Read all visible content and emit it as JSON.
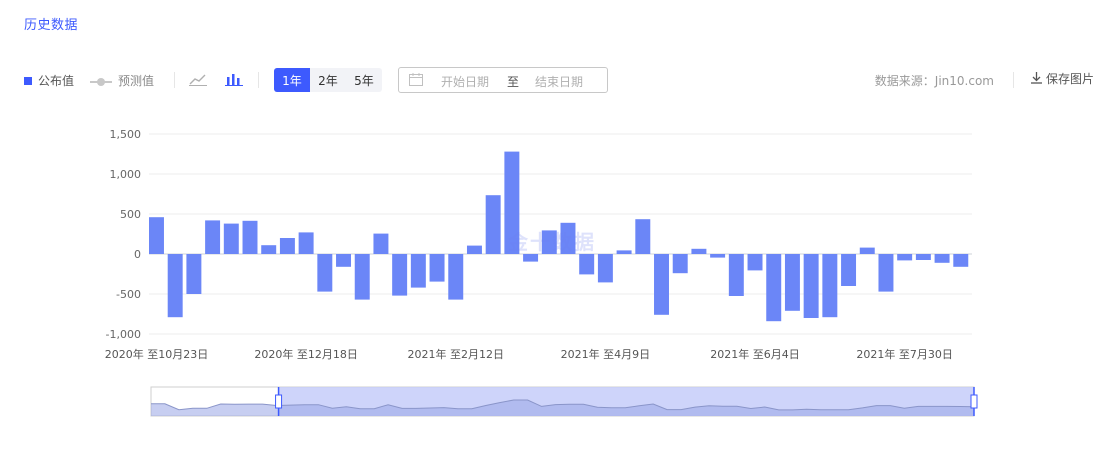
{
  "page": {
    "title": "历史数据"
  },
  "toolbar": {
    "legend_published": "公布值",
    "legend_forecast": "预测值",
    "icons": {
      "line": "line-chart-icon",
      "bar": "bar-chart-icon",
      "calendar": "calendar-icon",
      "download": "download-icon"
    },
    "ranges": [
      "1年",
      "2年",
      "5年"
    ],
    "active_range": "1年",
    "start_placeholder": "开始日期",
    "to_label": "至",
    "end_placeholder": "结束日期",
    "source": "数据来源：Jin10.com",
    "save_label": "保存图片"
  },
  "watermark": "金十数据",
  "colors": {
    "accent": "#3d5afe",
    "bar": "#6b86f7",
    "navigator_fill": "#c5ccf9",
    "navigator_area": "#99a6e6"
  },
  "chart_data": {
    "type": "bar",
    "title": "",
    "xlabel": "",
    "ylabel": "",
    "ylim": [
      -1000,
      1500
    ],
    "yticks": [
      1500,
      1000,
      500,
      0,
      -500,
      -1000
    ],
    "ytick_labels": [
      "1,500",
      "1,000",
      "500",
      "0",
      "-500",
      "-1,000"
    ],
    "xtick_labels": [
      "2020年 至10月23日",
      "2020年 至12月18日",
      "2021年 至2月12日",
      "2021年 至4月9日",
      "2021年 至6月4日",
      "2021年 至7月30日"
    ],
    "grid": true,
    "values": [
      460,
      -790,
      -500,
      420,
      380,
      415,
      110,
      200,
      270,
      -470,
      -160,
      -570,
      255,
      -520,
      -420,
      -345,
      -570,
      105,
      735,
      1280,
      -95,
      295,
      390,
      -255,
      -355,
      45,
      435,
      -760,
      -240,
      65,
      -45,
      -525,
      -205,
      -840,
      -710,
      -800,
      -790,
      -400,
      80,
      -470,
      -80,
      -75,
      -110,
      -160
    ]
  }
}
